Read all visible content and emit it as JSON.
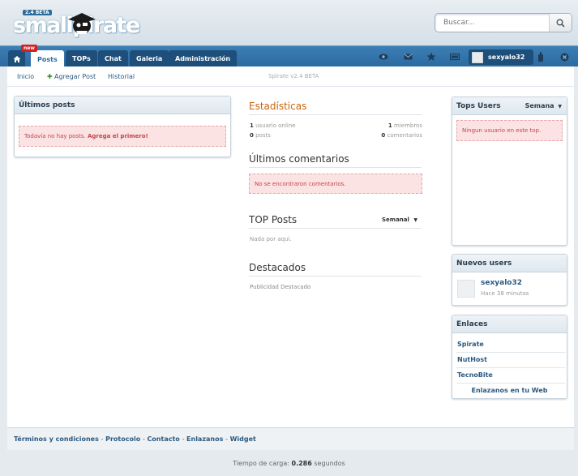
{
  "header": {
    "logo_text": "smallpirate",
    "logo_badge": "2.4 BETA",
    "search_placeholder": "Buscar..."
  },
  "nav": {
    "new_badge": "new",
    "tabs": [
      {
        "label": "Posts"
      },
      {
        "label": "TOPs"
      },
      {
        "label": "Chat"
      },
      {
        "label": "Galeria"
      },
      {
        "label": "Administración"
      }
    ],
    "username": "sexyalo32",
    "icons": [
      "eye-icon",
      "mail-icon",
      "star-icon",
      "monitor-icon",
      "bottle-icon",
      "close-icon"
    ]
  },
  "subnav": {
    "inicio": "Inicio",
    "agregar_post": "Agregar Post",
    "historial": "Historial",
    "version": "Spirate v2.4 BETA"
  },
  "ultimos_posts": {
    "title": "Últimos posts",
    "empty_text": "Todavía no hay posts.",
    "empty_link": "Agrega el primero!"
  },
  "estadisticas": {
    "title": "Estadísticas",
    "usuarios_online_count": "1",
    "usuarios_online_label": "usuario online",
    "miembros_count": "1",
    "miembros_label": "miembros",
    "posts_count": "0",
    "posts_label": "posts",
    "comentarios_count": "0",
    "comentarios_label": "comentarios"
  },
  "ultimos_comentarios": {
    "title": "Últimos comentarios",
    "empty_text": "No se encontraron comentarios."
  },
  "top_posts": {
    "title": "TOP Posts",
    "period": "Semanal",
    "empty_text": "Nada por aqui."
  },
  "destacados": {
    "title": "Destacados",
    "text": "Publicidad Destacado"
  },
  "tops_users": {
    "title": "Tops Users",
    "period": "Semana",
    "empty_text": "Ningun usuario en este top."
  },
  "nuevos_users": {
    "title": "Nuevos users",
    "username": "sexyalo32",
    "time": "Hace 38 minutos"
  },
  "enlaces": {
    "title": "Enlaces",
    "items": [
      "Spirate",
      "NutHost",
      "TecnoBite"
    ],
    "cta": "Enlazanos en tu Web"
  },
  "footer": {
    "terminos": "Términos y condiciones",
    "protocolo": "Protocolo",
    "contacto": "Contacto",
    "enlazanos": "Enlazanos",
    "widget": "Widget",
    "load_label": "Tiempo de carga:",
    "load_value": "0.286",
    "load_unit": "segundos"
  },
  "colors": {
    "nav_blue": "#2c6aa0",
    "accent_orange": "#c8640c",
    "alert_bg": "#fbe3e4",
    "alert_text": "#c3444d"
  }
}
